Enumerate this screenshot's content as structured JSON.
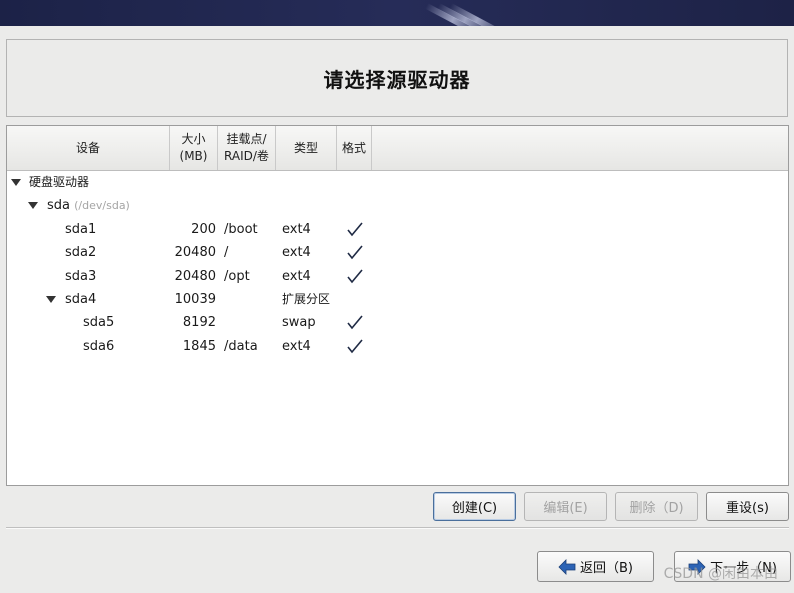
{
  "title": "请选择源驱动器",
  "columns": {
    "device": "设备",
    "size_line1": "大小",
    "size_line2": "(MB)",
    "mount_line1": "挂载点/",
    "mount_line2": "RAID/卷",
    "type": "类型",
    "format": "格式"
  },
  "tree": {
    "group_label": "硬盘驱动器",
    "disk_name": "sda",
    "disk_path": "(/dev/sda)",
    "partitions": [
      {
        "name": "sda1",
        "size": "200",
        "mount": "/boot",
        "type": "ext4",
        "format": true
      },
      {
        "name": "sda2",
        "size": "20480",
        "mount": "/",
        "type": "ext4",
        "format": true
      },
      {
        "name": "sda3",
        "size": "20480",
        "mount": "/opt",
        "type": "ext4",
        "format": true
      },
      {
        "name": "sda4",
        "size": "10039",
        "mount": "",
        "type": "扩展分区",
        "format": false
      },
      {
        "name": "sda5",
        "size": "8192",
        "mount": "",
        "type": "swap",
        "format": true
      },
      {
        "name": "sda6",
        "size": "1845",
        "mount": "/data",
        "type": "ext4",
        "format": true
      }
    ]
  },
  "buttons": {
    "create": "创建(C)",
    "edit": "编辑(E)",
    "delete": "删除（D)",
    "reset": "重设(s)",
    "back": "返回（B)",
    "next": "下一步（N)"
  },
  "watermark": "CSDN @闲由本由",
  "colors": {
    "banner": "#1f2550",
    "focus_border": "#4a6f9c",
    "arrow_blue": "#2c63b5"
  }
}
